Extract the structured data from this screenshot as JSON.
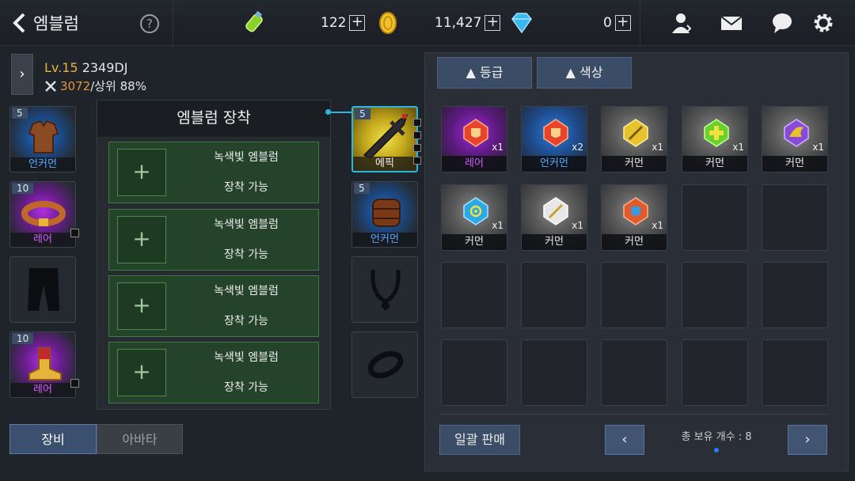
{
  "header": {
    "title": "엠블럼",
    "help_label": "?",
    "currencies": [
      {
        "icon": "energy-potion-icon",
        "value": "122",
        "add_label": "+"
      },
      {
        "icon": "gold-coin-icon",
        "value": "11,427",
        "add_label": "+"
      },
      {
        "icon": "diamond-icon",
        "value": "0",
        "add_label": "+"
      }
    ],
    "icons": [
      "friends-icon",
      "mail-icon",
      "chat-icon",
      "settings-icon"
    ]
  },
  "character": {
    "expand_label": "›",
    "level_label": "Lv.15",
    "name": "2349DJ",
    "power": "3072",
    "rank": "/상위 88%"
  },
  "equipment": {
    "left_slots": [
      {
        "level": "5",
        "rarity": "언커먼",
        "icon": "leather-armor-icon",
        "color": "#5aa8ff"
      },
      {
        "level": "10",
        "rarity": "레어",
        "icon": "belt-icon",
        "color": "#d060ff"
      },
      {
        "level": "",
        "rarity": "",
        "icon": "pants-silhouette-icon"
      },
      {
        "level": "10",
        "rarity": "레어",
        "icon": "boots-icon",
        "color": "#d060ff"
      }
    ],
    "right_slots": [
      {
        "level": "5",
        "rarity": "에픽",
        "icon": "greatsword-icon",
        "color": "#ffe34a"
      },
      {
        "level": "5",
        "rarity": "언커먼",
        "icon": "gauntlet-icon",
        "color": "#5aa8ff"
      },
      {
        "level": "",
        "rarity": "",
        "icon": "necklace-silhouette-icon"
      },
      {
        "level": "",
        "rarity": "",
        "icon": "ring-silhouette-icon"
      }
    ]
  },
  "emblem_panel": {
    "title": "엠블럼 장착",
    "rows": [
      {
        "plus": "+",
        "line1": "녹색빛 엠블럼",
        "line2": "장착 가능"
      },
      {
        "plus": "+",
        "line1": "녹색빛 엠블럼",
        "line2": "장착 가능"
      },
      {
        "plus": "+",
        "line1": "녹색빛 엠블럼",
        "line2": "장착 가능"
      },
      {
        "plus": "+",
        "line1": "녹색빛 엠블럼",
        "line2": "장착 가능"
      }
    ]
  },
  "bottom_tabs": {
    "equip": "장비",
    "avatar": "아바타"
  },
  "inventory": {
    "filters": [
      {
        "label": "▲ 등급"
      },
      {
        "label": "▲ 색상"
      }
    ],
    "items": [
      {
        "name": "레어",
        "count": "x1",
        "icon": "red-shield-gem-icon",
        "gem_color": "#e8442a",
        "name_color": "#d060ff"
      },
      {
        "name": "언커먼",
        "count": "x2",
        "icon": "red-shield-gem-icon",
        "gem_color": "#e8442a",
        "name_color": "#5aa8ff"
      },
      {
        "name": "커먼",
        "count": "x1",
        "icon": "yellow-sword-gem-icon",
        "gem_color": "#e8c22a",
        "name_color": "#e8e8e8"
      },
      {
        "name": "커먼",
        "count": "x1",
        "icon": "green-cross-gem-icon",
        "gem_color": "#6ad02a",
        "name_color": "#e8e8e8"
      },
      {
        "name": "커먼",
        "count": "x1",
        "icon": "purple-wing-gem-icon",
        "gem_color": "#8a4ad8",
        "name_color": "#e8e8e8"
      },
      {
        "name": "커먼",
        "count": "x1",
        "icon": "blue-target-gem-icon",
        "gem_color": "#2aa8e8",
        "name_color": "#e8e8e8"
      },
      {
        "name": "커먼",
        "count": "x1",
        "icon": "white-sword-gem-icon",
        "gem_color": "#e8e8e8",
        "name_color": "#e8e8e8"
      },
      {
        "name": "커먼",
        "count": "x1",
        "icon": "red-blue-shield-gem-icon",
        "gem_color": "#e05a2a",
        "name_color": "#e8e8e8"
      }
    ],
    "sell_all_label": "일괄 판매",
    "prev_label": "‹",
    "next_label": "›",
    "total_label": "총 보유 개수 : 8"
  }
}
